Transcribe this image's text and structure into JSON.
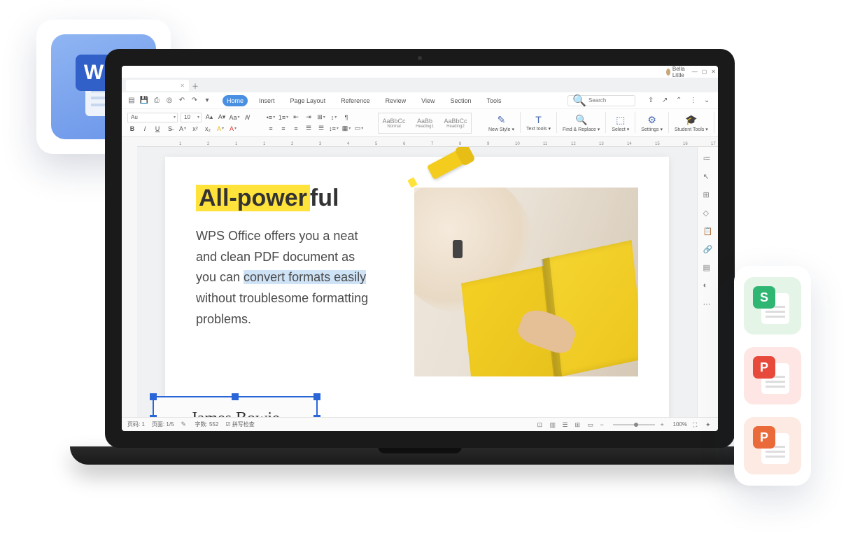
{
  "user": {
    "name": "Bella Little"
  },
  "menu": [
    "Home",
    "Insert",
    "Page Layout",
    "Reference",
    "Review",
    "View",
    "Section",
    "Tools"
  ],
  "active_menu": "Home",
  "search_placeholder": "Search",
  "font_name": "Au",
  "font_size": "10",
  "styles": [
    {
      "sample": "AaBbCc",
      "label": "Normal"
    },
    {
      "sample": "AaBb",
      "label": "Heading1"
    },
    {
      "sample": "AaBbCc",
      "label": "Heading2"
    }
  ],
  "ribbon_big": [
    {
      "icon": "✎",
      "label": "New Style ▾"
    },
    {
      "icon": "T",
      "label": "Text tools ▾"
    },
    {
      "icon": "🔍",
      "label": "Find & Replace ▾"
    },
    {
      "icon": "⬚",
      "label": "Select ▾"
    },
    {
      "icon": "⚙",
      "label": "Settings ▾"
    },
    {
      "icon": "🎓",
      "label": "Student Tools ▾"
    }
  ],
  "ruler": [
    "1",
    "2",
    "1",
    "1",
    "2",
    "3",
    "4",
    "5",
    "6",
    "7",
    "8",
    "9",
    "10",
    "11",
    "12",
    "13",
    "14",
    "15",
    "16",
    "17"
  ],
  "document": {
    "title_hl": "All-power",
    "title_rest": "ful",
    "body_pre": "WPS Office offers you a neat and clean PDF document as you can ",
    "body_hl": "convert formats easily",
    "body_post": " without troublesome formatting problems.",
    "signature": "James Bowie"
  },
  "status": {
    "page_label": "页码:",
    "page_value": "1",
    "pages_label": "页面:",
    "pages_value": "1/5",
    "wordcount_label": "字数:",
    "wordcount_value": "552",
    "spellcheck": "拼写检查",
    "zoom": "100%"
  },
  "badges": {
    "writer": "W",
    "sheet": "S",
    "pdf": "P",
    "presentation": "P"
  }
}
